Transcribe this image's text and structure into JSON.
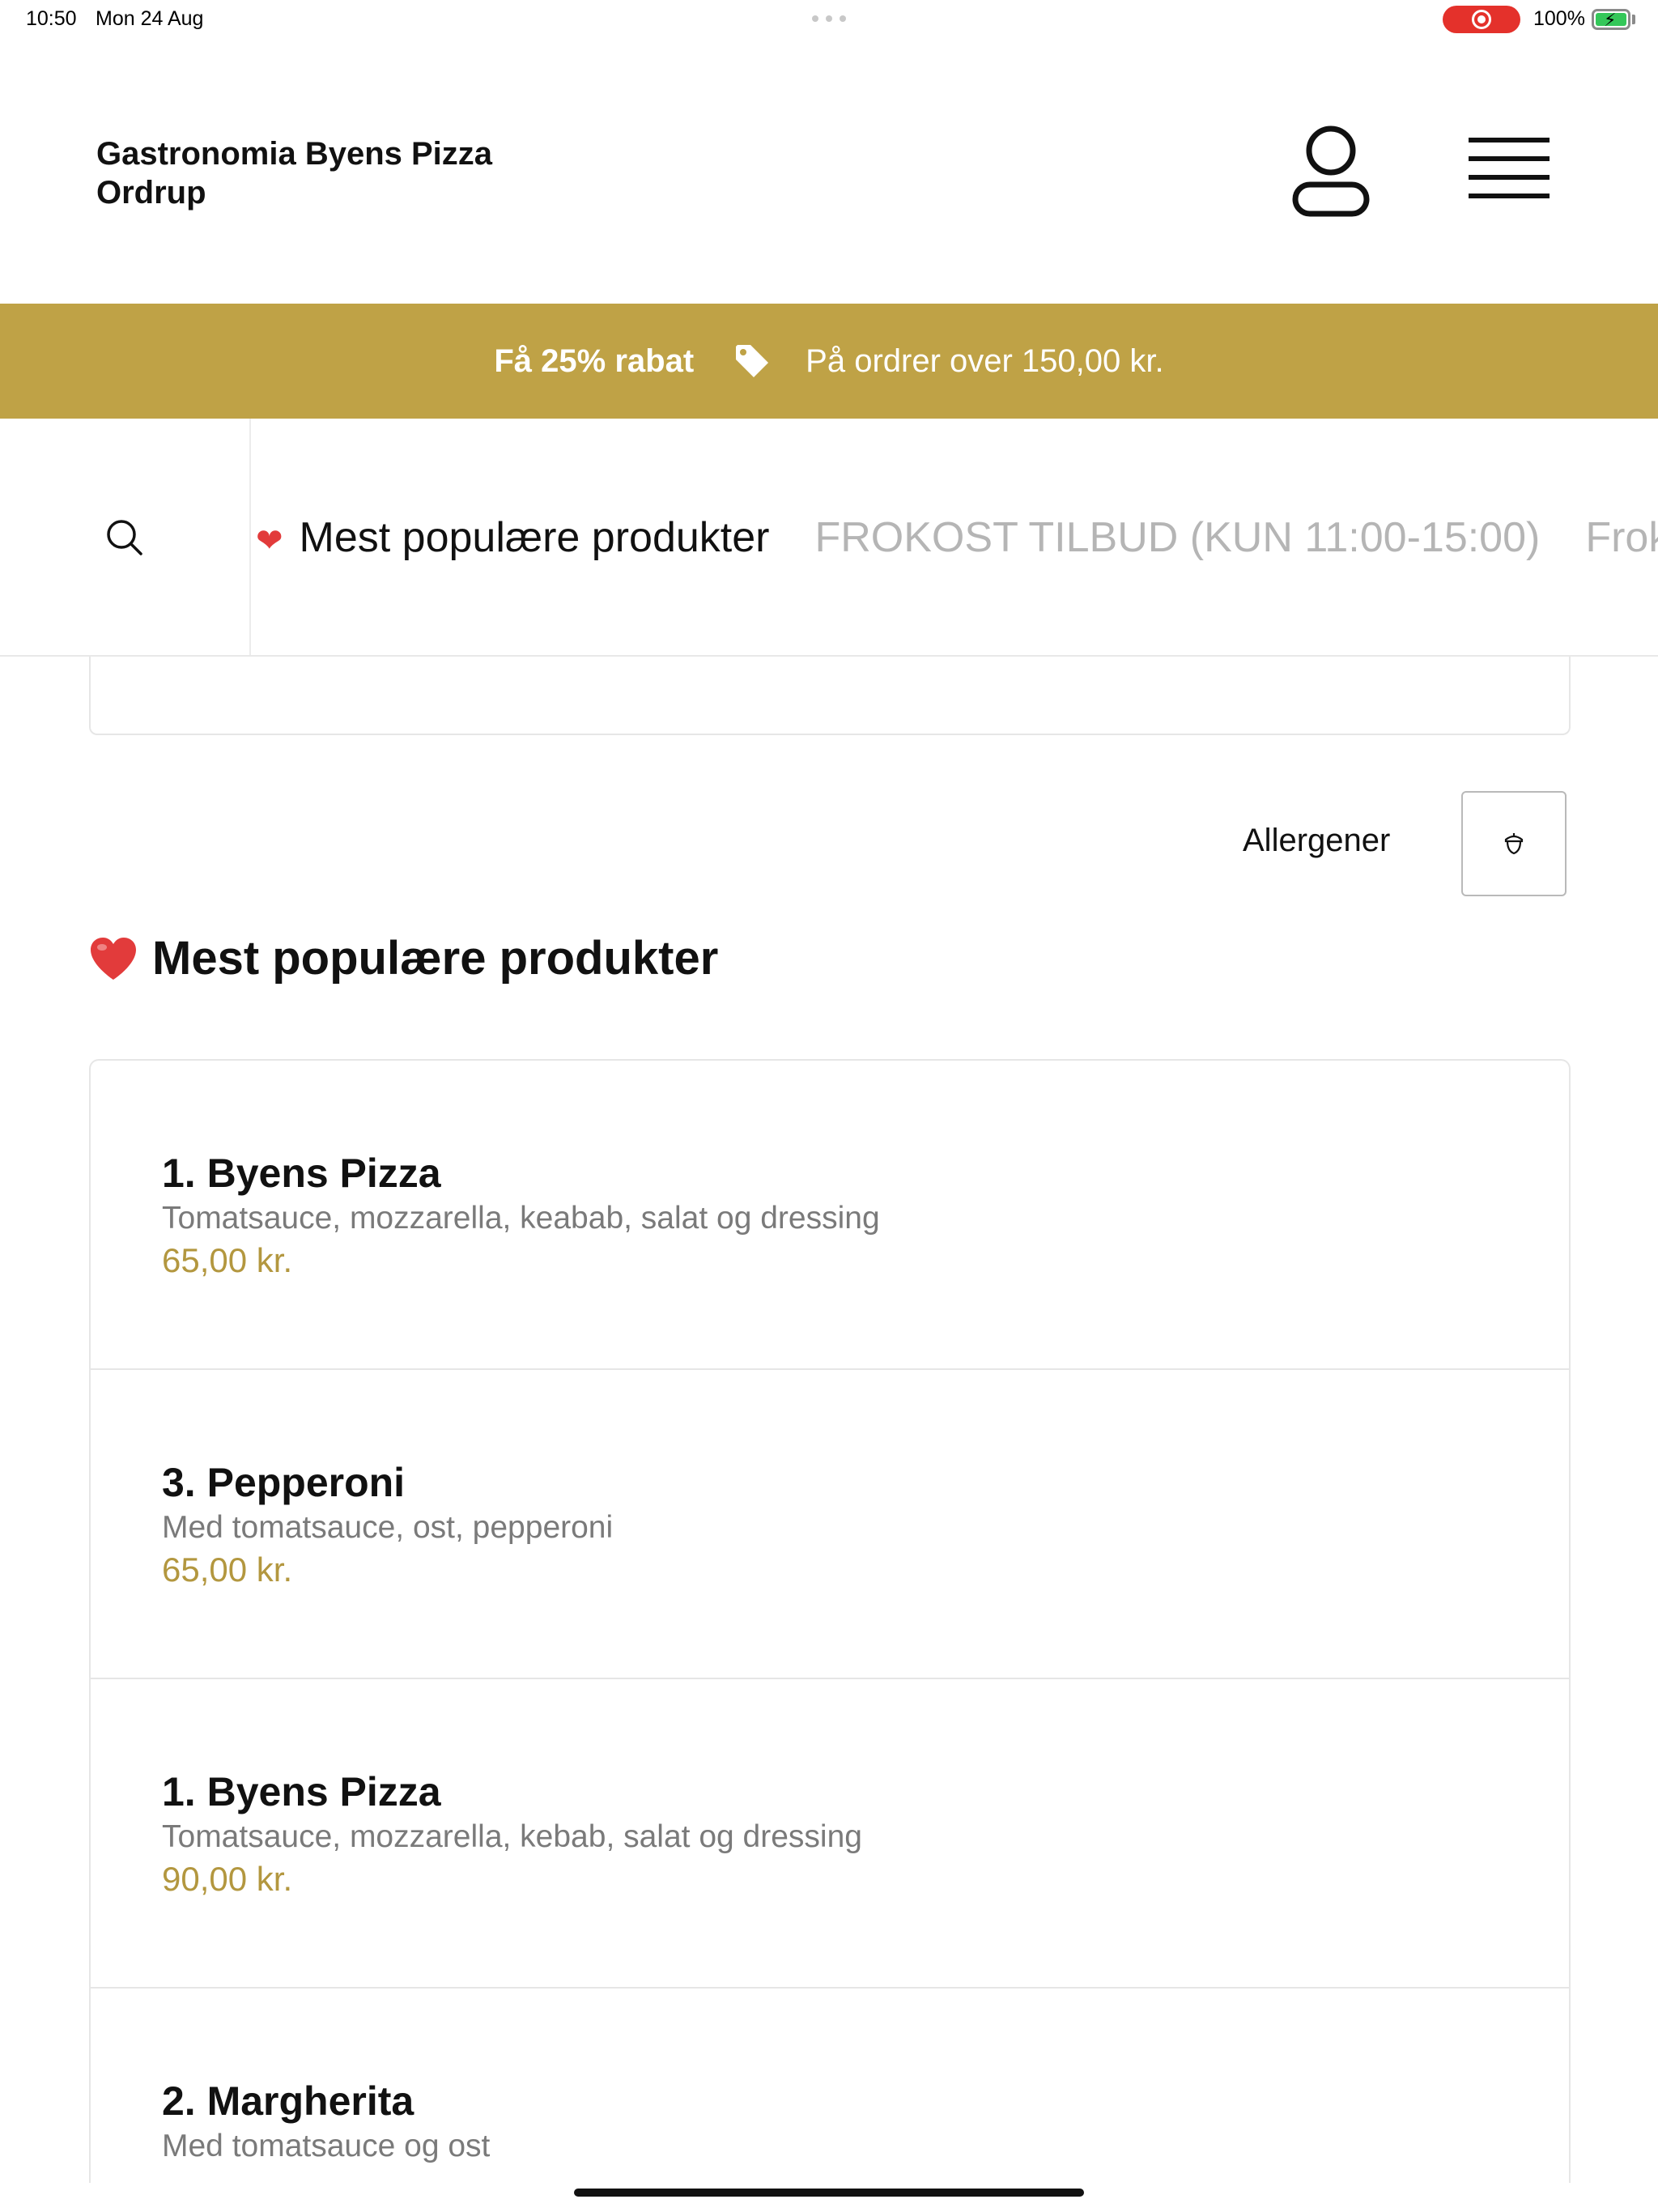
{
  "status_bar": {
    "time": "10:50",
    "date": "Mon 24 Aug",
    "battery": "100%"
  },
  "header": {
    "restaurant_name": "Gastronomia Byens Pizza Ordrup",
    "user_icon": "user-icon",
    "menu_icon": "hamburger-menu-icon"
  },
  "promo": {
    "headline": "Få 25% rabat",
    "icon": "tag-icon",
    "detail": "På ordrer over 150,00 kr.",
    "background": "#bfa246"
  },
  "category_nav": {
    "search_icon": "search-icon",
    "categories": [
      {
        "label": "Mest populære produkter",
        "active": true
      },
      {
        "label": "FROKOST TILBUD (KUN 11:00-15:00)",
        "active": false
      },
      {
        "label": "Frokos",
        "active": false
      }
    ]
  },
  "allergens": {
    "label": "Allergener",
    "icon": "acorn-icon"
  },
  "section": {
    "title": "Mest populære produkter",
    "icon": "red-heart-emoji"
  },
  "products": [
    {
      "name": "1. Byens Pizza",
      "description": "Tomatsauce, mozzarella, keabab, salat og dressing",
      "price": "65,00 kr."
    },
    {
      "name": "3. Pepperoni",
      "description": "Med tomatsauce, ost, pepperoni",
      "price": "65,00 kr."
    },
    {
      "name": "1. Byens Pizza",
      "description": "Tomatsauce, mozzarella, kebab, salat og dressing",
      "price": "90,00 kr."
    },
    {
      "name": "2. Margherita",
      "description": "Med tomatsauce og ost",
      "price": ""
    }
  ],
  "colors": {
    "accent": "#bfa246",
    "price": "#b3973f",
    "heart": "#e23b3b"
  }
}
